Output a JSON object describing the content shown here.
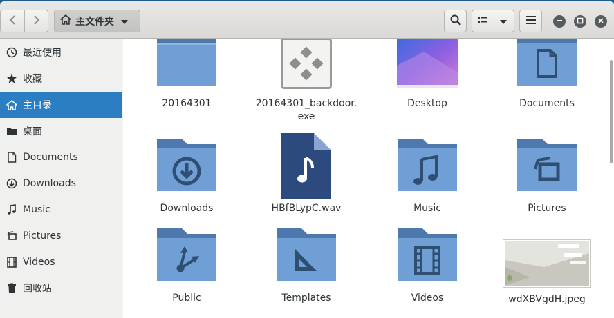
{
  "header": {
    "path_label": "主文件夹",
    "icons": {
      "back": "chevron-left-icon",
      "forward": "chevron-right-icon",
      "home": "home-icon",
      "search": "search-icon",
      "list": "view-list-icon",
      "menu": "hamburger-menu-icon"
    }
  },
  "sidebar": {
    "items": [
      {
        "label": "最近使用",
        "icon": "recent-clock-icon",
        "active": false
      },
      {
        "label": "收藏",
        "icon": "star-icon",
        "active": false
      },
      {
        "label": "主目录",
        "icon": "home-icon",
        "active": true
      },
      {
        "label": "桌面",
        "icon": "desktop-folder-icon",
        "active": false
      },
      {
        "label": "Documents",
        "icon": "document-icon",
        "active": false
      },
      {
        "label": "Downloads",
        "icon": "download-icon",
        "active": false
      },
      {
        "label": "Music",
        "icon": "music-note-icon",
        "active": false
      },
      {
        "label": "Pictures",
        "icon": "pictures-icon",
        "active": false
      },
      {
        "label": "Videos",
        "icon": "film-icon",
        "active": false
      },
      {
        "label": "回收站",
        "icon": "trash-icon",
        "active": false
      }
    ]
  },
  "files": [
    {
      "name": "20164301",
      "type": "folder"
    },
    {
      "name": "20164301_backdoor.\nexe",
      "type": "executable"
    },
    {
      "name": "Desktop",
      "type": "desktop-thumbnail"
    },
    {
      "name": "Documents",
      "type": "folder-documents"
    },
    {
      "name": "Downloads",
      "type": "folder-downloads"
    },
    {
      "name": "HBfBLypC.wav",
      "type": "audio-file"
    },
    {
      "name": "Music",
      "type": "folder-music"
    },
    {
      "name": "Pictures",
      "type": "folder-pictures"
    },
    {
      "name": "Public",
      "type": "folder-public"
    },
    {
      "name": "Templates",
      "type": "folder-templates"
    },
    {
      "name": "Videos",
      "type": "folder-videos"
    },
    {
      "name": "wdXBVgdH.jpeg",
      "type": "image-thumbnail"
    }
  ],
  "colors": {
    "accent": "#2a7ec1",
    "folder_body": "#6f9fd4",
    "folder_tab": "#4d79ad",
    "folder_glyph": "#2f4f72"
  }
}
